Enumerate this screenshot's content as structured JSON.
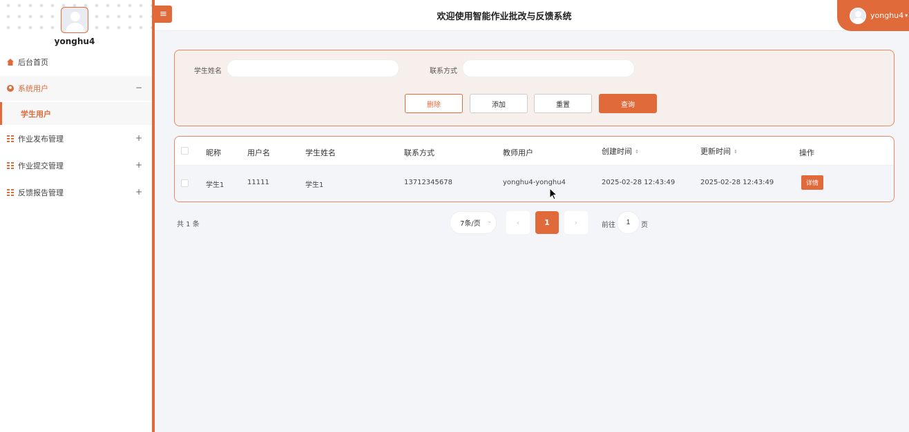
{
  "sidebar": {
    "username": "yonghu4",
    "items": [
      {
        "label": "后台首页",
        "icon": "home-icon"
      },
      {
        "label": "系统用户",
        "icon": "user-icon",
        "toggle": "−",
        "expanded": true
      },
      {
        "label": "作业发布管理",
        "icon": "grid-icon",
        "toggle": "+"
      },
      {
        "label": "作业提交管理",
        "icon": "grid-icon",
        "toggle": "+"
      },
      {
        "label": "反馈报告管理",
        "icon": "grid-icon",
        "toggle": "+"
      }
    ],
    "sub_active": "学生用户"
  },
  "header": {
    "menu_toggle": "≡",
    "title": "欢迎使用智能作业批改与反馈系统",
    "user": "yonghu4",
    "caret": "▾"
  },
  "search": {
    "name_label": "学生姓名",
    "name_value": "",
    "contact_label": "联系方式",
    "contact_value": "",
    "buttons": {
      "delete": "删除",
      "add": "添加",
      "reset": "重置",
      "query": "查询"
    }
  },
  "table": {
    "columns": [
      "昵称",
      "用户名",
      "学生姓名",
      "联系方式",
      "教师用户",
      "创建时间",
      "更新时间",
      "操作"
    ],
    "sort_glyph": "⇕",
    "rows": [
      {
        "nickname": "学生1",
        "username": "11111",
        "student_name": "学生1",
        "contact": "13712345678",
        "teacher": "yonghu4-yonghu4",
        "created": "2025-02-28 12:43:49",
        "updated": "2025-02-28 12:43:49",
        "action": "详情"
      }
    ]
  },
  "pagination": {
    "total": "共 1 条",
    "page_size": "7条/页",
    "prev": "‹",
    "current": "1",
    "next": "›",
    "goto_prefix": "前往",
    "goto_value": "1",
    "goto_suffix": "页"
  },
  "colors": {
    "accent": "#e06a3a",
    "panel_bg": "#f6efec",
    "page_bg": "#f4f5f9"
  }
}
